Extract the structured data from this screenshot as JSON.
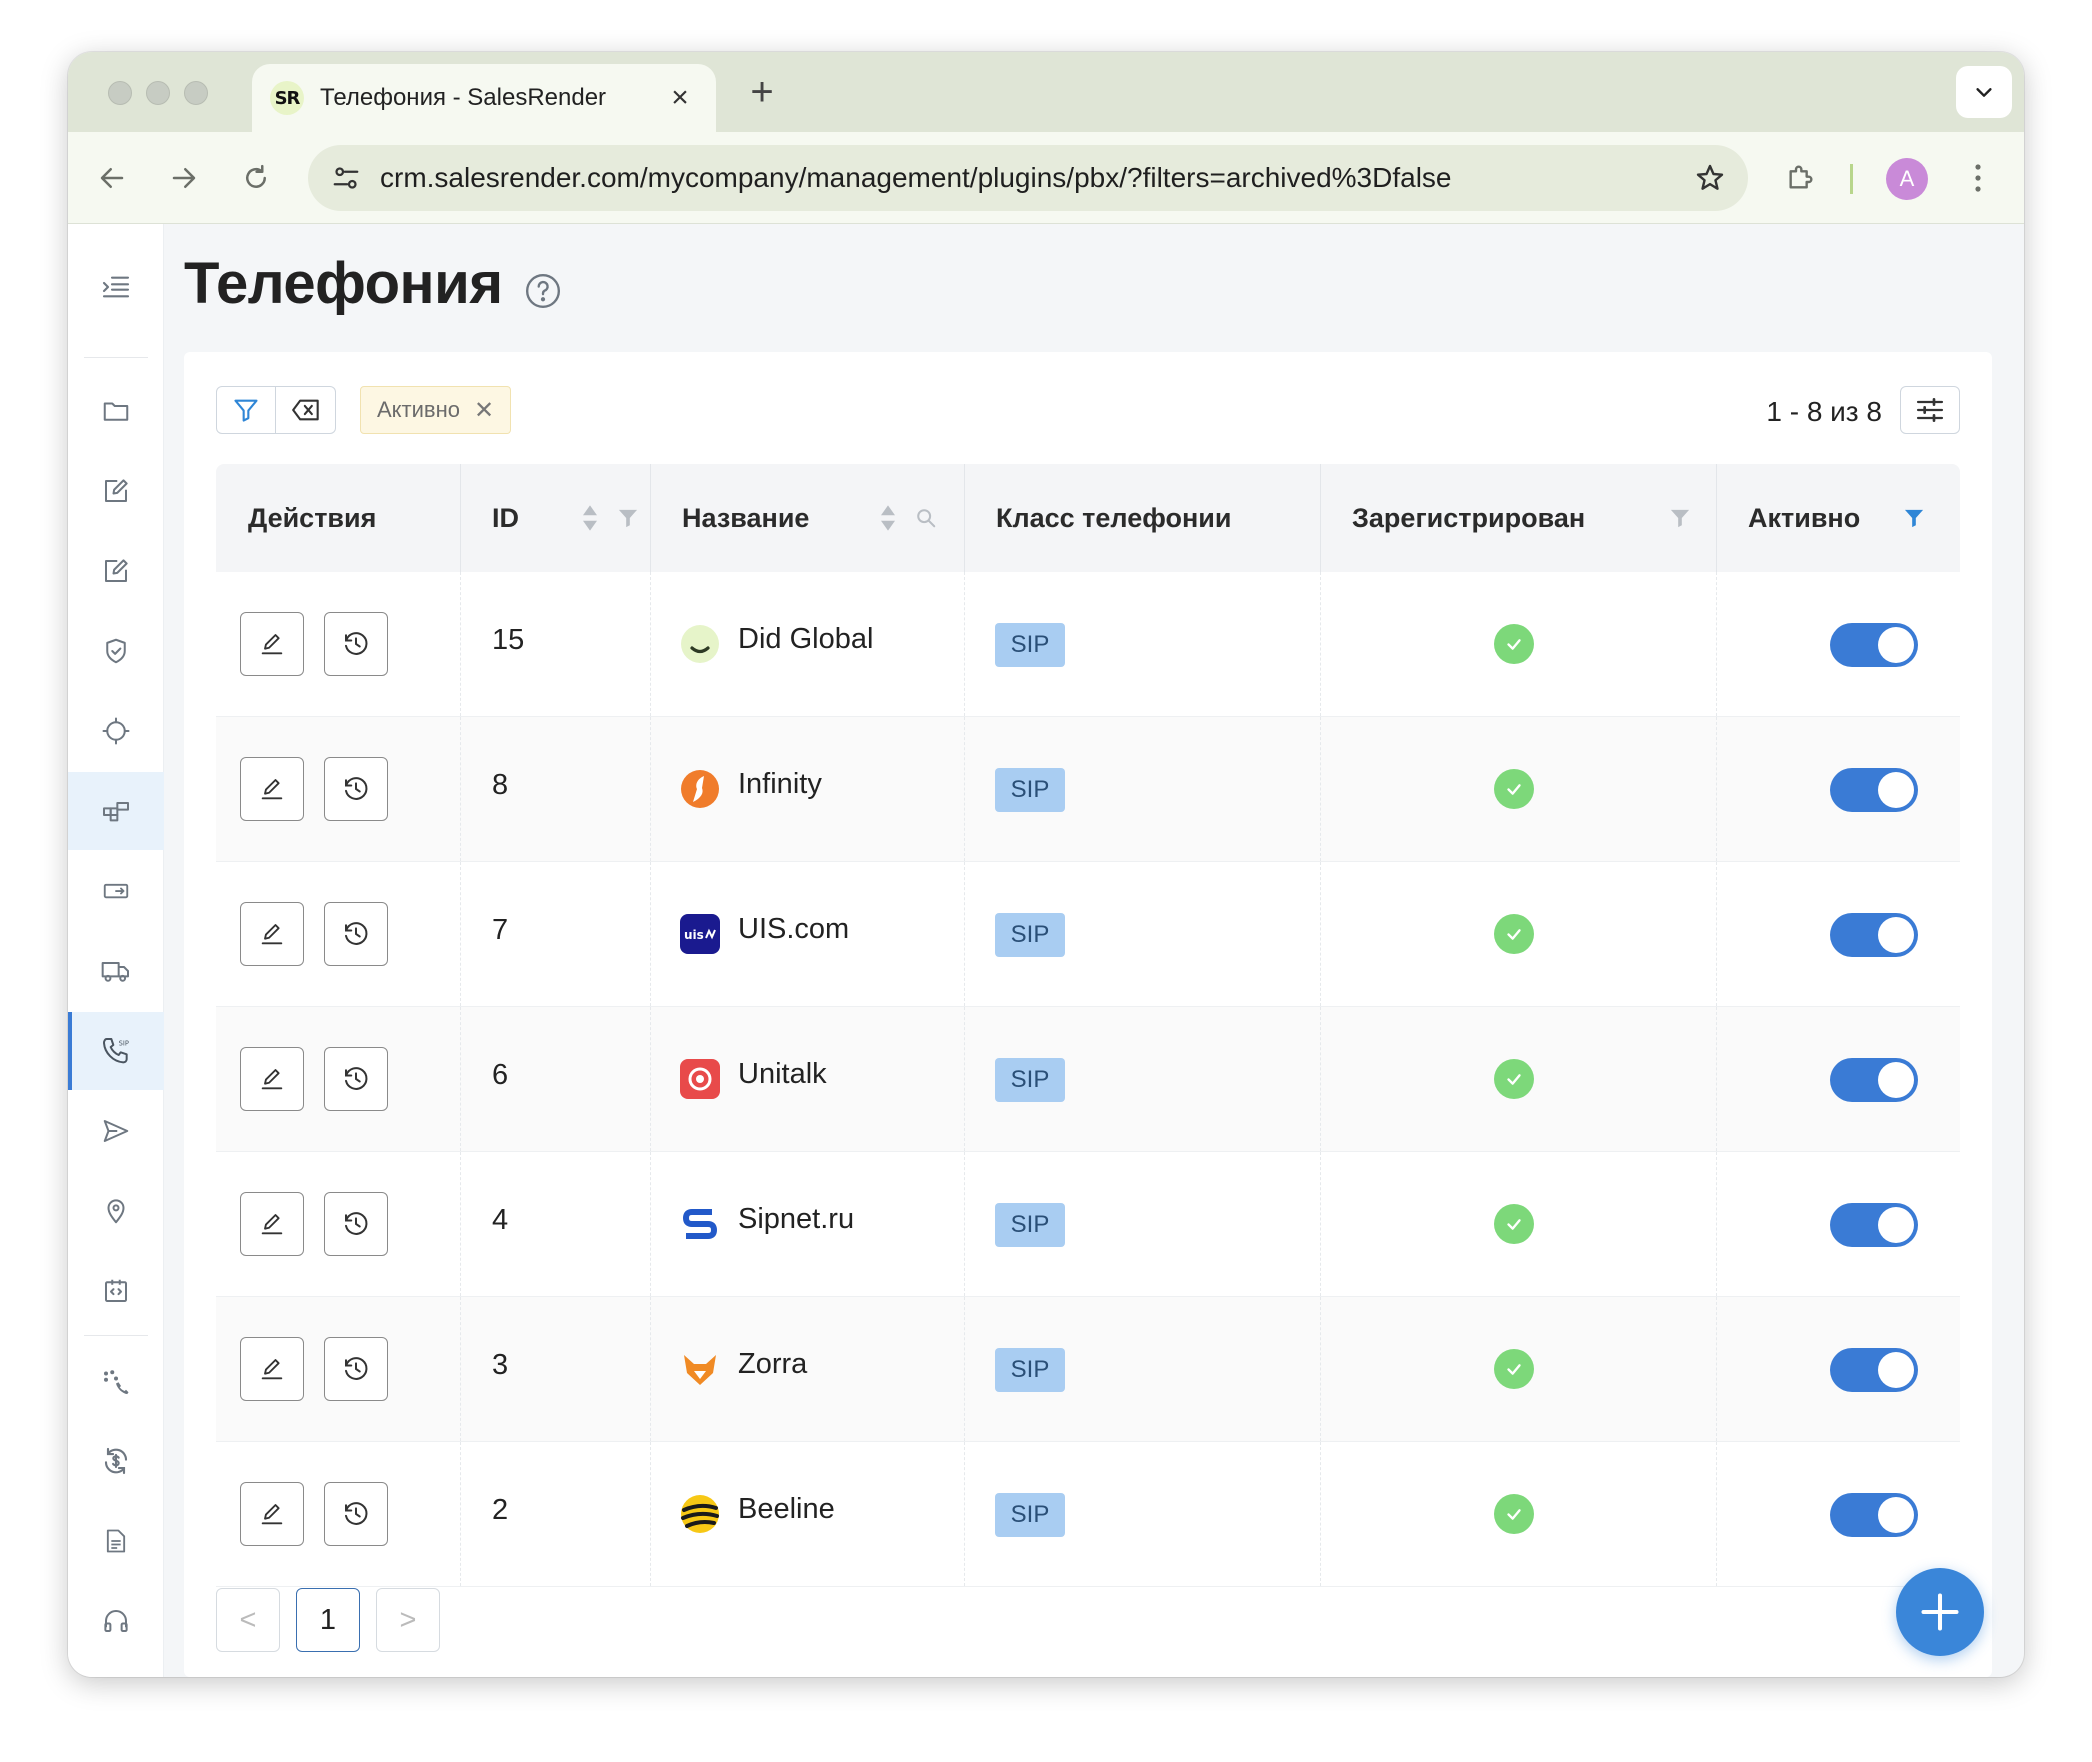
{
  "browser": {
    "tab_title": "Телефония - SalesRender",
    "tab_favicon_text": "SR",
    "url": "crm.salesrender.com/mycompany/management/plugins/pbx/?filters=archived%3Dfalse",
    "avatar_letter": "A",
    "colors": {
      "tabbar": "#dfe5d6",
      "toolbar": "#f6f9f1",
      "omnibox": "#e6ebdc"
    }
  },
  "sidebar": {
    "items": [
      {
        "icon": "menu-expand-icon"
      },
      {
        "icon": "folder-icon"
      },
      {
        "icon": "edit-note-icon"
      },
      {
        "icon": "edit-note-icon"
      },
      {
        "icon": "shield-check-icon"
      },
      {
        "icon": "crosshair-icon"
      },
      {
        "icon": "modules-icon",
        "state": "active"
      },
      {
        "icon": "card-transfer-icon"
      },
      {
        "icon": "truck-icon"
      },
      {
        "icon": "phone-sip-icon",
        "state": "current"
      },
      {
        "icon": "send-icon"
      },
      {
        "icon": "location-pin-icon"
      },
      {
        "icon": "code-box-icon"
      },
      {
        "icon": "dial-icon"
      },
      {
        "icon": "currency-sync-icon"
      },
      {
        "icon": "document-icon"
      },
      {
        "icon": "headphones-icon"
      }
    ]
  },
  "page": {
    "title": "Телефония",
    "filter_chip": "Активно",
    "pager_info": "1 - 8 из 8"
  },
  "table": {
    "columns": [
      "Действия",
      "ID",
      "Название",
      "Класс телефонии",
      "Зарегистрирован",
      "Активно"
    ],
    "rows": [
      {
        "id": "15",
        "name": "Did Global",
        "logo": "did-global-logo",
        "class": "SIP",
        "registered": true,
        "active": true
      },
      {
        "id": "8",
        "name": "Infinity",
        "logo": "infinity-logo",
        "class": "SIP",
        "registered": true,
        "active": true
      },
      {
        "id": "7",
        "name": "UIS.com",
        "logo": "uis-logo",
        "class": "SIP",
        "registered": true,
        "active": true
      },
      {
        "id": "6",
        "name": "Unitalk",
        "logo": "unitalk-logo",
        "class": "SIP",
        "registered": true,
        "active": true
      },
      {
        "id": "4",
        "name": "Sipnet.ru",
        "logo": "sipnet-logo",
        "class": "SIP",
        "registered": true,
        "active": true
      },
      {
        "id": "3",
        "name": "Zorra",
        "logo": "zorra-logo",
        "class": "SIP",
        "registered": true,
        "active": true
      },
      {
        "id": "2",
        "name": "Beeline",
        "logo": "beeline-logo",
        "class": "SIP",
        "registered": true,
        "active": true
      }
    ]
  },
  "pagination": {
    "prev": "<",
    "current": "1",
    "next": ">"
  },
  "colors": {
    "accent": "#3a7bd5",
    "sip_badge": "#a9cdf2",
    "registered_check": "#7dd87a",
    "chip_bg": "#fdf7e3"
  }
}
